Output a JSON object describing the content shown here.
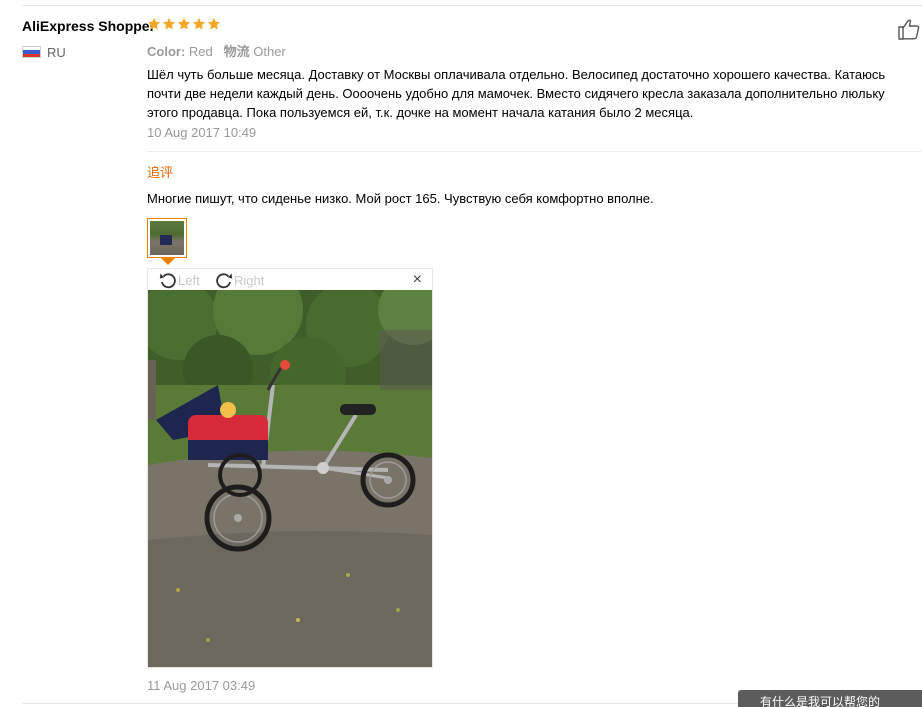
{
  "reviewer": {
    "name": "AliExpress Shopper",
    "country_code": "RU",
    "rating": 5
  },
  "review": {
    "meta": {
      "color_label": "Color:",
      "color_value": "Red",
      "shipping_label": "物流",
      "shipping_value": "Other"
    },
    "lines": [
      "Шёл чуть больше месяца. Доставку от Москвы оплачивала отдельно. Велосипед достаточно хорошего качества. Катаюсь",
      "почти две недели каждый день. Оооочень удобно для мамочек. Вместо сидячего кресла заказала дополнительно люльку",
      "этого продавца. Пока пользуемся ей, т.к. дочке на момент начала катания было 2 месяца."
    ],
    "date": "10 Aug 2017 10:49"
  },
  "followup": {
    "label": "追评",
    "text": "Многие пишут, что сиденье низко. Мой рост 165. Чувствую себя комфортно вполне.",
    "date": "11 Aug 2017 03:49"
  },
  "viewer": {
    "rotate_left_label": "Left",
    "rotate_right_label": "Right",
    "close_label": "×"
  },
  "chat_bar": {
    "text": "有什么是我可以帮您的"
  },
  "colors": {
    "star": "#f5a623",
    "accent": "#e56600",
    "thumb_border": "#f08200"
  }
}
